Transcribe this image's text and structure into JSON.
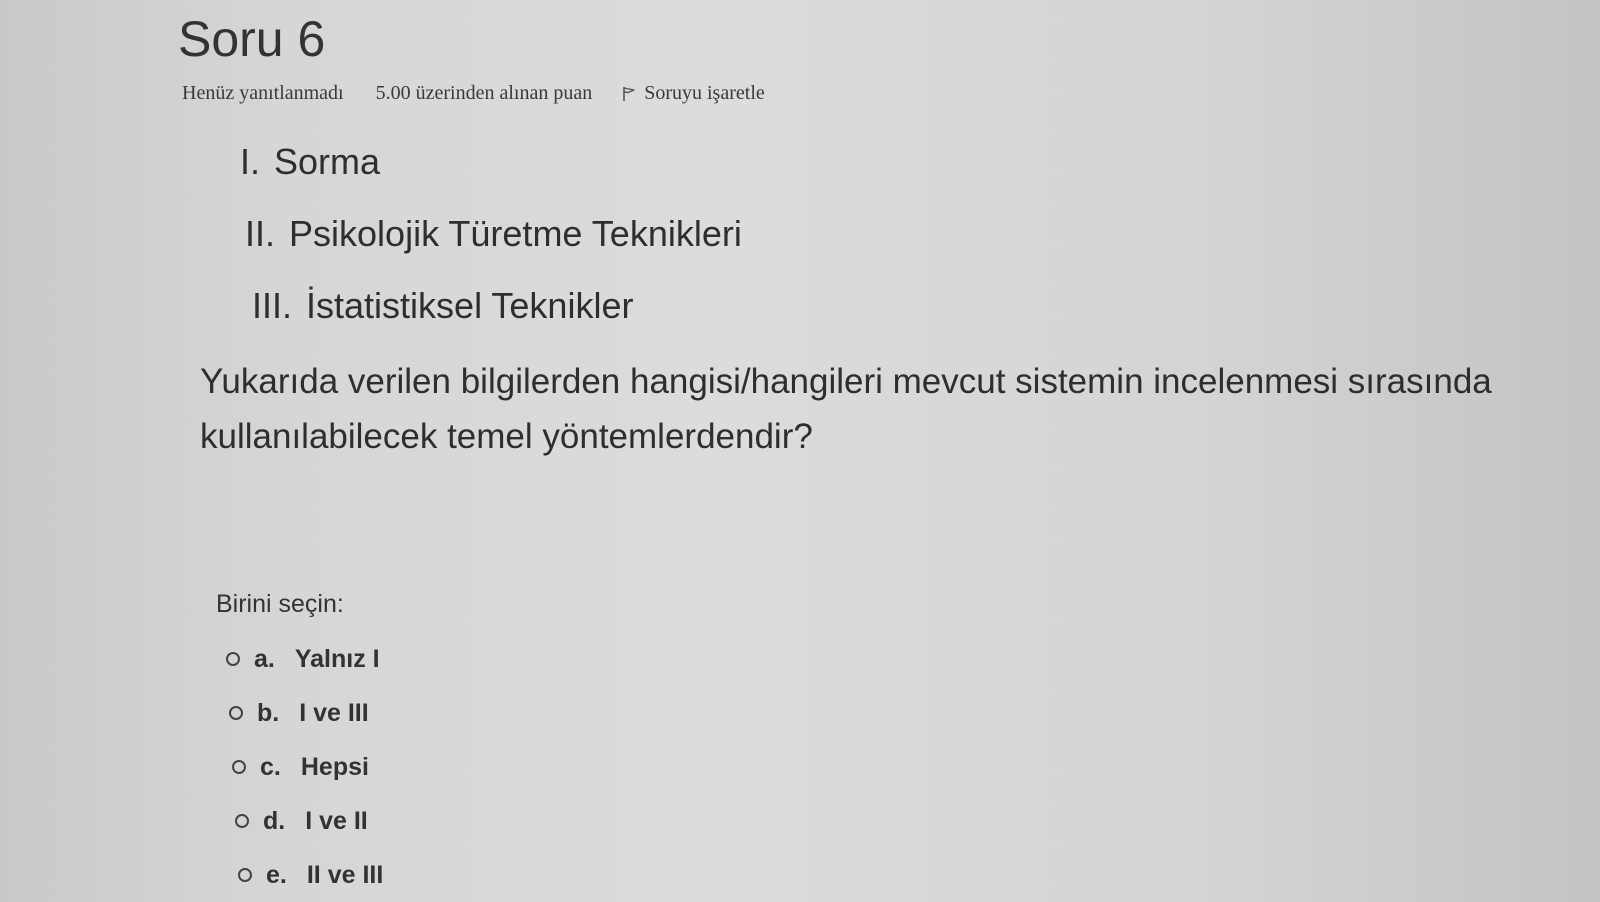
{
  "question": {
    "title": "Soru 6",
    "state": "Henüz yanıtlanmadı",
    "grade": "5.00 üzerinden alınan puan",
    "flag_label": "Soruyu işaretle",
    "flag_icon": "flag-icon",
    "statements": [
      {
        "num": "I.",
        "text": "Sorma"
      },
      {
        "num": "II.",
        "text": "Psikolojik Türetme Teknikleri"
      },
      {
        "num": "III.",
        "text": "İstatistiksel Teknikler"
      }
    ],
    "text": "Yukarıda verilen bilgilerden hangisi/hangileri mevcut sistemin incelenmesi sırasında kullanılabilecek temel yöntemlerdendir?",
    "prompt": "Birini seçin:",
    "answers": [
      {
        "letter": "a.",
        "text": "Yalnız I"
      },
      {
        "letter": "b.",
        "text": "I ve III"
      },
      {
        "letter": "c.",
        "text": "Hepsi"
      },
      {
        "letter": "d.",
        "text": "I ve II"
      },
      {
        "letter": "e.",
        "text": "II ve III"
      }
    ]
  }
}
